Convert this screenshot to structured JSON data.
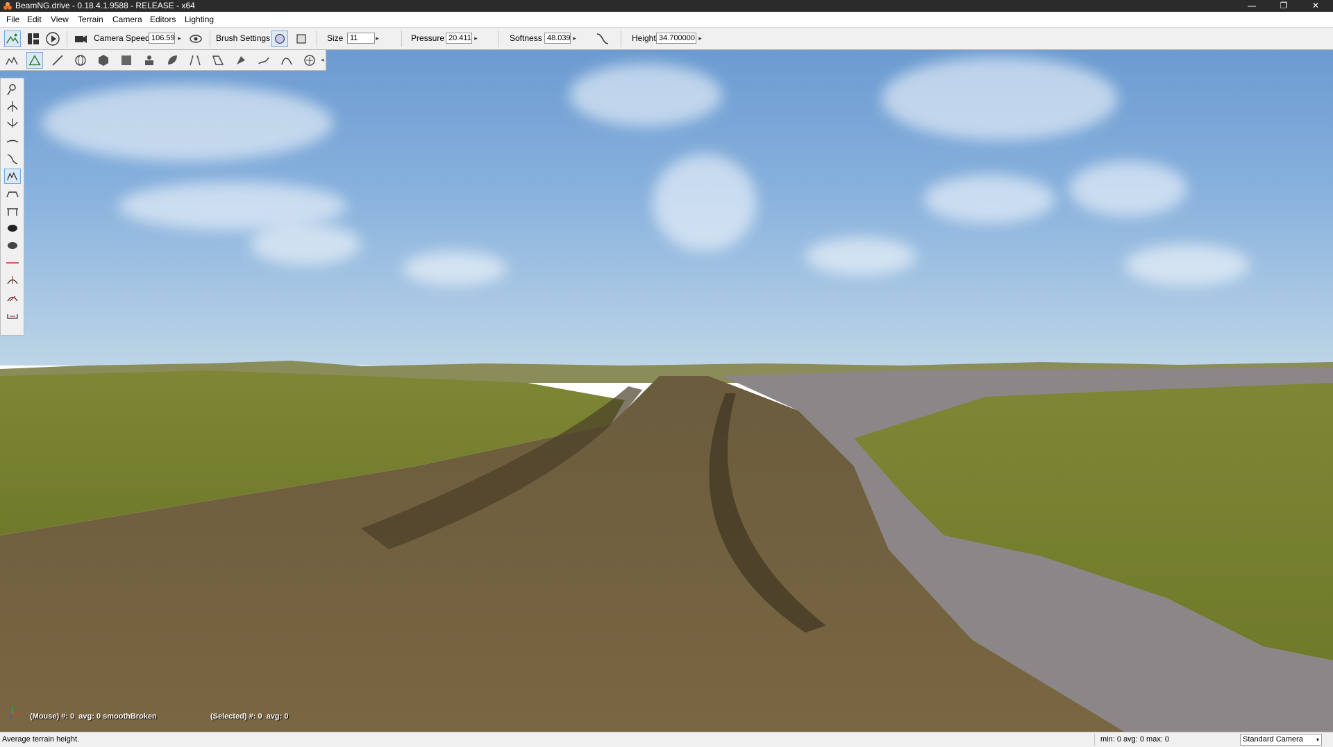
{
  "window": {
    "title": "BeamNG.drive - 0.18.4.1.9588 - RELEASE - x64",
    "minimize_glyph": "—",
    "maximize_glyph": "❐",
    "close_glyph": "✕"
  },
  "menu": {
    "items": [
      "File",
      "Edit",
      "View",
      "Terrain",
      "Camera",
      "Editors",
      "Lighting"
    ]
  },
  "toolbar": {
    "camera_speed_label": "Camera Speed",
    "camera_speed_value": "106.59",
    "brush_settings_label": "Brush Settings",
    "size_label": "Size",
    "size_value": "11",
    "pressure_label": "Pressure",
    "pressure_value": "20.411",
    "softness_label": "Softness",
    "softness_value": "48.039",
    "height_label": "Height",
    "height_value": "34.700000",
    "spin_glyph": "▸"
  },
  "viewport": {
    "mouse_info": "(Mouse) #: 0  avg: 0 smoothBroken",
    "selected_info": "(Selected) #: 0  avg: 0"
  },
  "statusbar": {
    "message": "Average terrain height.",
    "stats": "min: 0  avg: 0  max: 0",
    "camera_mode": "Standard Camera",
    "dropdown_glyph": "▾"
  },
  "colors": {
    "titlebar": "#2b2b2b",
    "toolbar": "#f0f0f0",
    "sky": "#88b1dd",
    "dirt": "#6f5e3c",
    "grass": "#7f8a34",
    "rock": "#8b8789"
  }
}
